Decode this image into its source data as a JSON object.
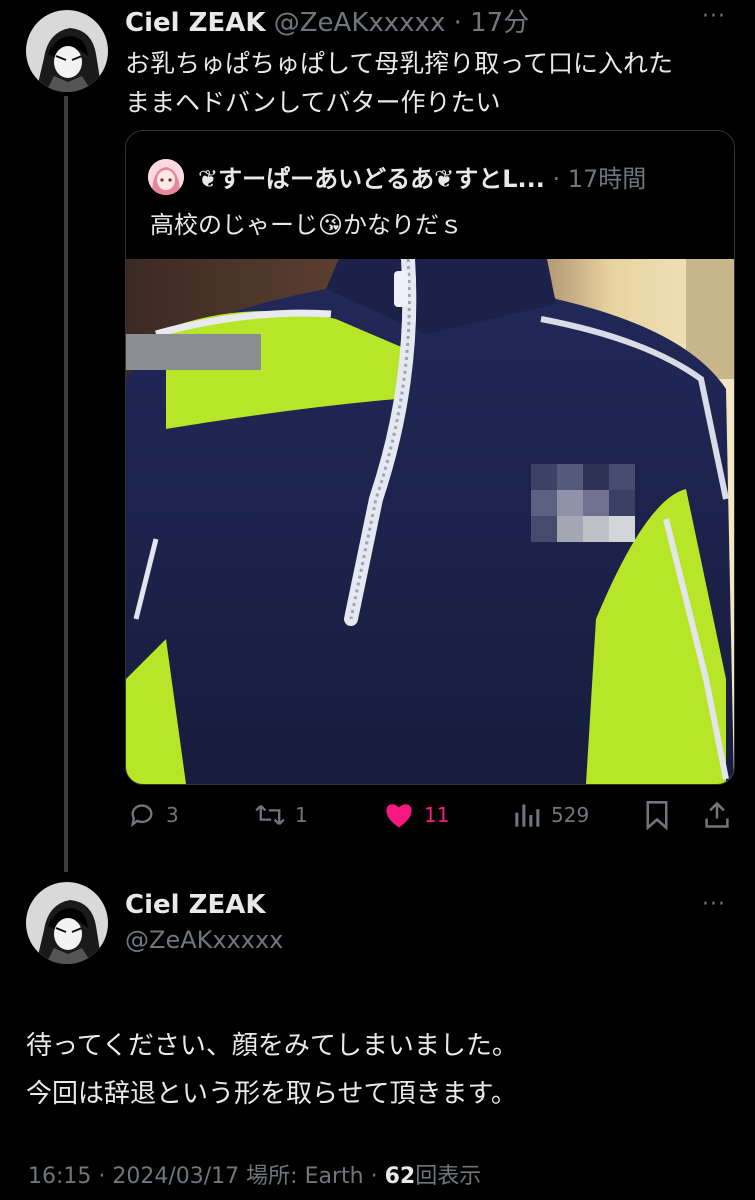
{
  "tweet1": {
    "name": "Ciel ZEAK",
    "handle": "@ZeAKxxxxx",
    "time": "17分",
    "text_line1": "お乳ちゅぱちゅぱして母乳搾り取って口に入れた",
    "text_line2": "ままヘドバンしてバター作りたい",
    "more": "···"
  },
  "quote": {
    "name": "❦すーぱーあいどるあ❦すとL...",
    "time": "17時間",
    "text_prefix": "高校のじゃーじ",
    "emoji": "😘",
    "text_suffix": "かなりだｓ"
  },
  "actions": {
    "reply_count": "3",
    "retweet_count": "1",
    "like_count": "11",
    "views_count": "529"
  },
  "tweet2": {
    "name": "Ciel ZEAK",
    "handle": "@ZeAKxxxxx",
    "more": "···",
    "text_line1": "待ってください、顔をみてしまいました。",
    "text_line2": "今回は辞退という形を取らせて頂きます。",
    "timestamp": "16:15 · 2024/03/17 場所: Earth · ",
    "views_number": "62",
    "views_label": "回表示"
  },
  "colors": {
    "like": "#f91880",
    "muted": "#71767b",
    "text": "#e7e9ea",
    "jersey_navy": "#1d2452",
    "jersey_lime": "#b7e629"
  }
}
